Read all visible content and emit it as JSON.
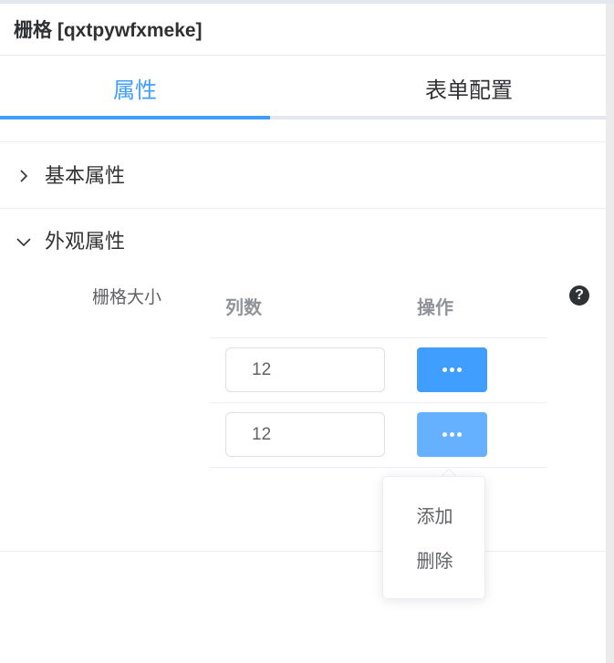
{
  "panel": {
    "title": "栅格 [qxtpywfxmeke]"
  },
  "tabs": [
    {
      "label": "属性",
      "active": true
    },
    {
      "label": "表单配置",
      "active": false
    }
  ],
  "sections": [
    {
      "label": "基本属性",
      "expanded": false
    },
    {
      "label": "外观属性",
      "expanded": true
    }
  ],
  "grid_size": {
    "label": "栅格大小",
    "help_icon": "question-circle-icon",
    "columns": [
      "列数",
      "操作"
    ],
    "rows": [
      {
        "value": "12"
      },
      {
        "value": "12"
      }
    ]
  },
  "menu": {
    "items": [
      "添加",
      "删除"
    ]
  },
  "colors": {
    "accent": "#409eff",
    "accent_hover": "#66b1ff",
    "text": "#303133",
    "muted": "#909399"
  }
}
